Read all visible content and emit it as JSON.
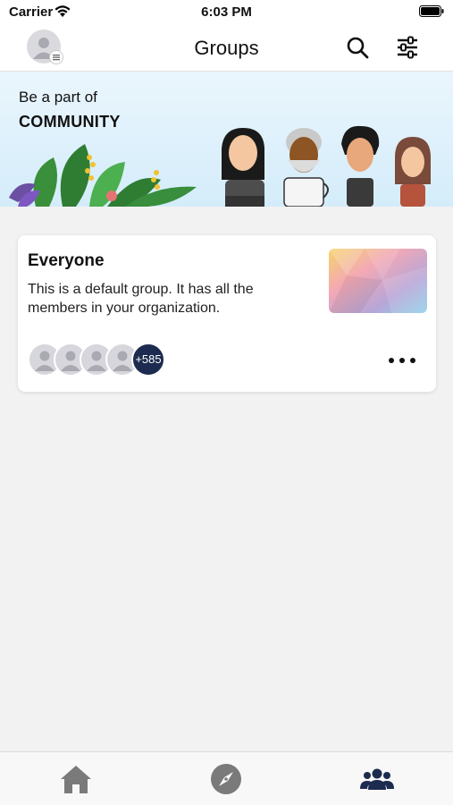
{
  "status_bar": {
    "carrier": "Carrier",
    "time": "6:03 PM"
  },
  "nav": {
    "title": "Groups"
  },
  "banner": {
    "line1": "Be a part of",
    "line2": "COMMUNITY"
  },
  "group": {
    "name": "Everyone",
    "description": "This is a default group. It has all the members in your organization.",
    "member_count": "+585"
  },
  "tabs": [
    "home",
    "explore",
    "groups"
  ],
  "colors": {
    "accent": "#1c2b4f",
    "tab_inactive": "#7a7a7a",
    "tab_active": "#1c2b4f"
  }
}
